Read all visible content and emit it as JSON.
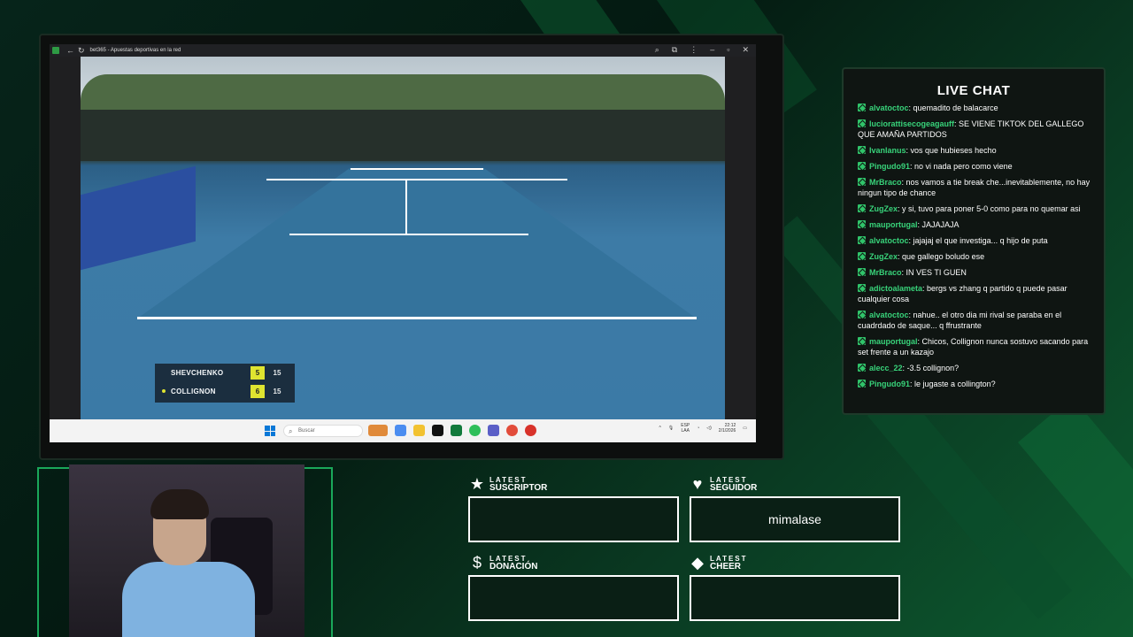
{
  "browser": {
    "title": "bet365 - Apuestas deportivas en la red"
  },
  "scoreboard": {
    "players": [
      {
        "name": "SHEVCHENKO",
        "games": "5",
        "points": "15"
      },
      {
        "name": "COLLIGNON",
        "games": "6",
        "points": "15"
      }
    ]
  },
  "taskbar": {
    "search_placeholder": "Buscar",
    "lang": "ESP",
    "lang2": "LAA",
    "time": "22:12",
    "date": "2/1/2026"
  },
  "chat": {
    "title": "LIVE CHAT",
    "messages": [
      {
        "user": "alvatoctoc",
        "text": "quemadito de balacarce"
      },
      {
        "user": "luciorattisecogeagauff",
        "text": "SE VIENE TIKTOK DEL GALLEGO QUE AMAÑA PARTIDOS"
      },
      {
        "user": "Ivanlanus",
        "text": "vos que hubieses hecho"
      },
      {
        "user": "Pingudo91",
        "text": "no vi nada pero como viene"
      },
      {
        "user": "MrBraco",
        "text": "nos vamos a tie break che...inevitablemente, no hay ningun tipo de chance"
      },
      {
        "user": "ZugZex",
        "text": "y si, tuvo para poner 5-0 como para no quemar asi"
      },
      {
        "user": "mauportugal",
        "text": "JAJAJAJA"
      },
      {
        "user": "alvatoctoc",
        "text": "jajajaj el que investiga... q hijo de puta"
      },
      {
        "user": "ZugZex",
        "text": "que gallego boludo ese"
      },
      {
        "user": "MrBraco",
        "text": "IN VES TI GUEN"
      },
      {
        "user": "adictoalameta",
        "text": "bergs vs zhang q partido q puede pasar cualquier cosa"
      },
      {
        "user": "alvatoctoc",
        "text": "nahue.. el otro dia mi rival se paraba en el cuadrdado de saque... q ffrustrante"
      },
      {
        "user": "mauportugal",
        "text": "Chicos, Collignon nunca sostuvo sacando para set frente a un kazajo"
      },
      {
        "user": "alecc_22",
        "text": "-3.5 collignon?"
      },
      {
        "user": "Pingudo91",
        "text": "le jugaste a collington?"
      }
    ]
  },
  "latest": {
    "suscriptor": {
      "top": "LATEST",
      "bottom": "SUSCRIPTOR",
      "value": ""
    },
    "seguidor": {
      "top": "LATEST",
      "bottom": "SEGUIDOR",
      "value": "mimalase"
    },
    "donacion": {
      "top": "LATEST",
      "bottom": "DONACIÓN",
      "value": ""
    },
    "cheer": {
      "top": "LATEST",
      "bottom": "CHEER",
      "value": ""
    }
  },
  "colors": {
    "accent": "#30c46a",
    "background": "#03150c",
    "score_highlight": "#e8ea2a"
  }
}
